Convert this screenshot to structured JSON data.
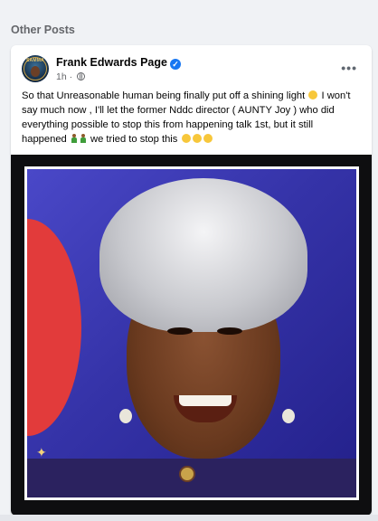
{
  "section": {
    "title": "Other Posts"
  },
  "post": {
    "author": "Frank Edwards Page",
    "time": "1h",
    "more_label": "•••",
    "text_1": "So that Unreasonable human being finally put off a shining light",
    "text_2": "I won't say much now , I'll let the former Nddc director ( AUNTY Joy ) who did everything possible to stop this from happening talk 1st, but it still happened",
    "text_3": "we tried to stop this"
  },
  "avatar": {
    "label": "SAMMA"
  },
  "colors": {
    "accent": "#1877f2",
    "background": "#f0f2f5",
    "card": "#ffffff"
  }
}
